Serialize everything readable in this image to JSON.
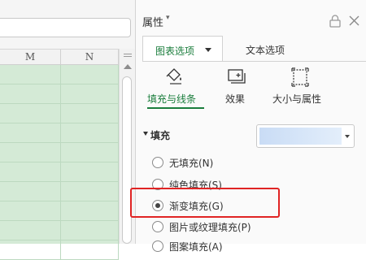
{
  "spreadsheet": {
    "columns": [
      "M",
      "N"
    ]
  },
  "panel": {
    "title": "属性",
    "title_caret": "▾",
    "tabs": [
      {
        "label": "图表选项",
        "active": true
      },
      {
        "label": "文本选项",
        "active": false
      }
    ],
    "sub_tabs": [
      {
        "label": "填充与线条",
        "icon": "fill-bucket-icon",
        "active": true
      },
      {
        "label": "效果",
        "icon": "effects-icon",
        "active": false
      },
      {
        "label": "大小与属性",
        "icon": "size-properties-icon",
        "active": false
      }
    ],
    "fill_section": {
      "title": "填充",
      "options": [
        {
          "label": "无填充(N)",
          "checked": false
        },
        {
          "label": "纯色填充(S)",
          "checked": false
        },
        {
          "label": "渐变填充(G)",
          "checked": true
        },
        {
          "label": "图片或纹理填充(P)",
          "checked": false
        },
        {
          "label": "图案填充(A)",
          "checked": false
        }
      ]
    }
  },
  "colors": {
    "accent_green": "#1a7d3c",
    "highlight_red": "#e02424",
    "cell_fill": "#d4ead6",
    "gradient_swatch_start": "#c9dcf5",
    "gradient_swatch_end": "#e3eefb"
  }
}
